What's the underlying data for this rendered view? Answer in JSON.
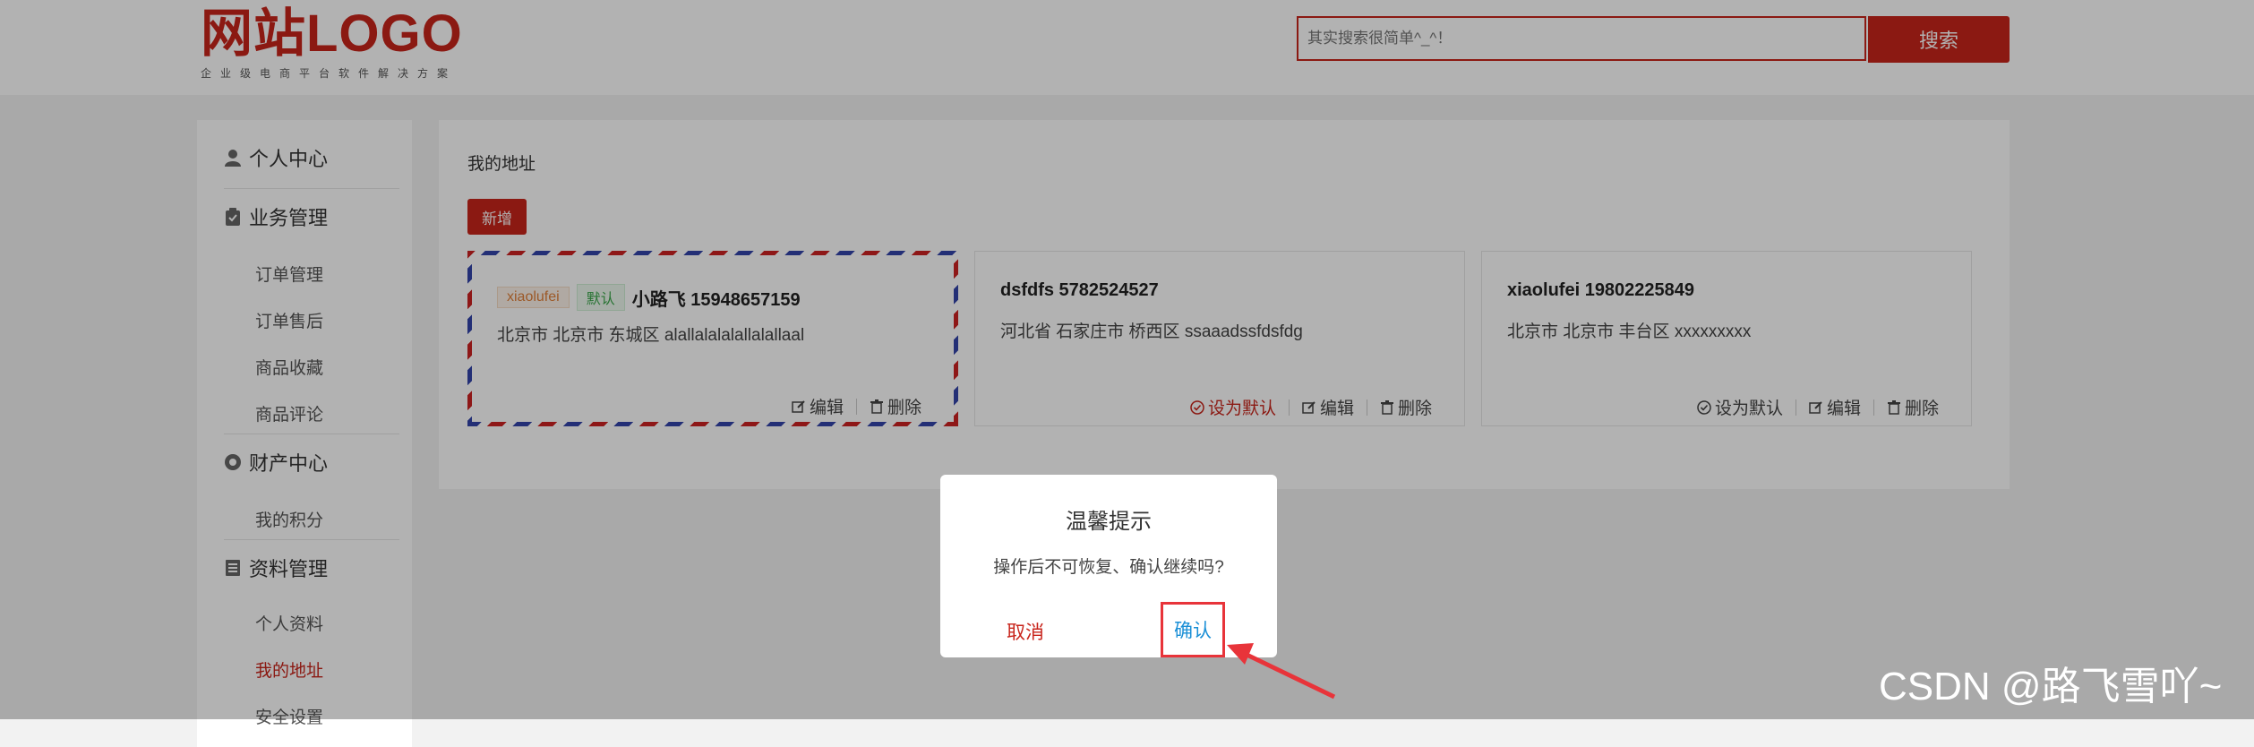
{
  "header": {
    "logo_main": "网站LOGO",
    "logo_sub": "企业级电商平台软件解决方案",
    "search_placeholder": "其实搜索很简单^_^！",
    "search_button": "搜索"
  },
  "sidebar": {
    "groups": [
      {
        "label": "个人中心",
        "icon": "user-icon"
      },
      {
        "label": "业务管理",
        "icon": "clipboard-icon"
      },
      {
        "label": "财产中心",
        "icon": "coin-icon"
      },
      {
        "label": "资料管理",
        "icon": "document-icon"
      }
    ],
    "items": [
      "订单管理",
      "订单售后",
      "商品收藏",
      "商品评论",
      "我的积分",
      "个人资料",
      "我的地址",
      "安全设置"
    ],
    "active_item": "我的地址"
  },
  "main": {
    "title": "我的地址",
    "add_button": "新增",
    "addresses": [
      {
        "tag_user": "xiaolufei",
        "tag_default": "默认",
        "name_phone": "小路飞 15948657159",
        "address": "北京市 北京市 东城区 alallalalalallalallaal",
        "edit": "编辑",
        "delete": "删除"
      },
      {
        "name_phone": "dsfdfs 5782524527",
        "address": "河北省 石家庄市 桥西区 ssaaadssfdsfdg",
        "set_default": "设为默认",
        "edit": "编辑",
        "delete": "删除"
      },
      {
        "name_phone": "xiaolufei 19802225849",
        "address": "北京市 北京市 丰台区 xxxxxxxxx",
        "set_default": "设为默认",
        "edit": "编辑",
        "delete": "删除"
      }
    ]
  },
  "dialog": {
    "title": "温馨提示",
    "message": "操作后不可恢复、确认继续吗?",
    "cancel": "取消",
    "confirm": "确认"
  },
  "watermark": "CSDN @路飞雪吖~",
  "colors": {
    "brand": "#c8241b",
    "confirm_text": "#1a8fd6",
    "highlight_border": "#e8343a",
    "overlay": "rgba(0,0,0,0.3)"
  }
}
